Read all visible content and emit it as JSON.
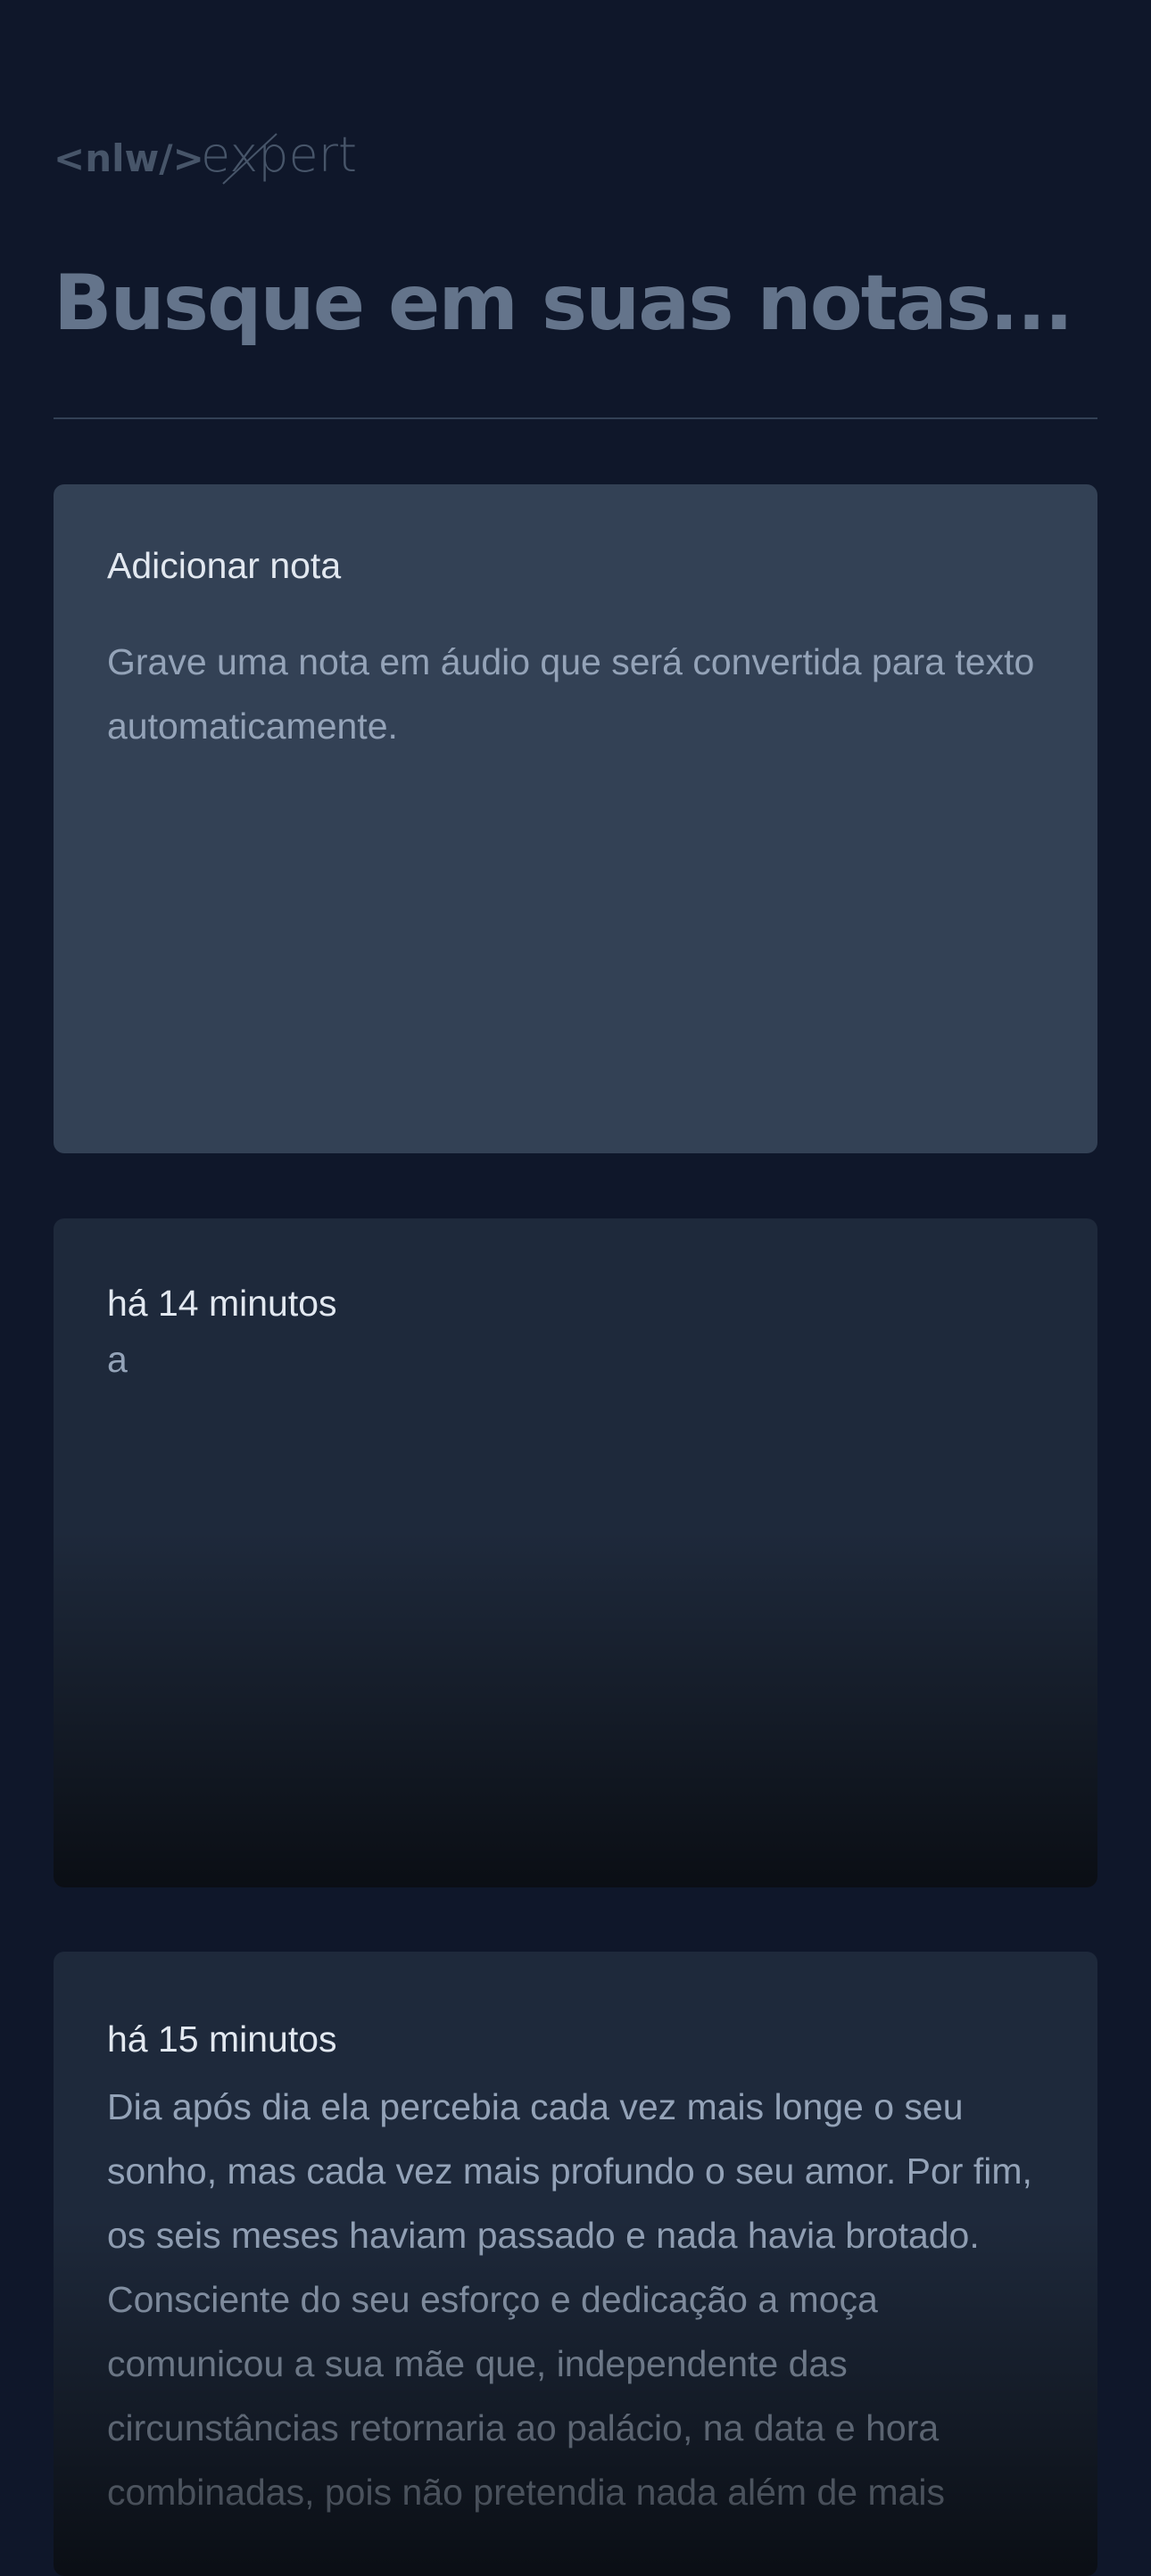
{
  "header": {
    "logo_alt": "<nlw/> expert",
    "logo_left": "<nlw/>",
    "logo_right": "expert"
  },
  "search": {
    "placeholder": "Busque em suas notas..."
  },
  "add_note": {
    "title": "Adicionar nota",
    "description": "Grave uma nota em áudio que será convertida para texto automaticamente."
  },
  "notes": [
    {
      "time": "há 14 minutos",
      "content": "a"
    },
    {
      "time": "há 15 minutos",
      "content": "Dia após dia ela percebia cada vez mais longe o seu sonho, mas cada vez mais profundo o seu amor. Por fim, os seis meses haviam passado e nada havia brotado. Consciente do seu esforço e dedicação a moça comunicou a sua mãe que, independente das circunstâncias retornaria ao palácio, na data e hora combinadas, pois não pretendia nada além de mais"
    }
  ],
  "colors": {
    "background": "#0f172a",
    "add_card": "#334155",
    "note_card": "#1e293b",
    "placeholder": "#64748b",
    "muted_text": "#94a3b8"
  }
}
